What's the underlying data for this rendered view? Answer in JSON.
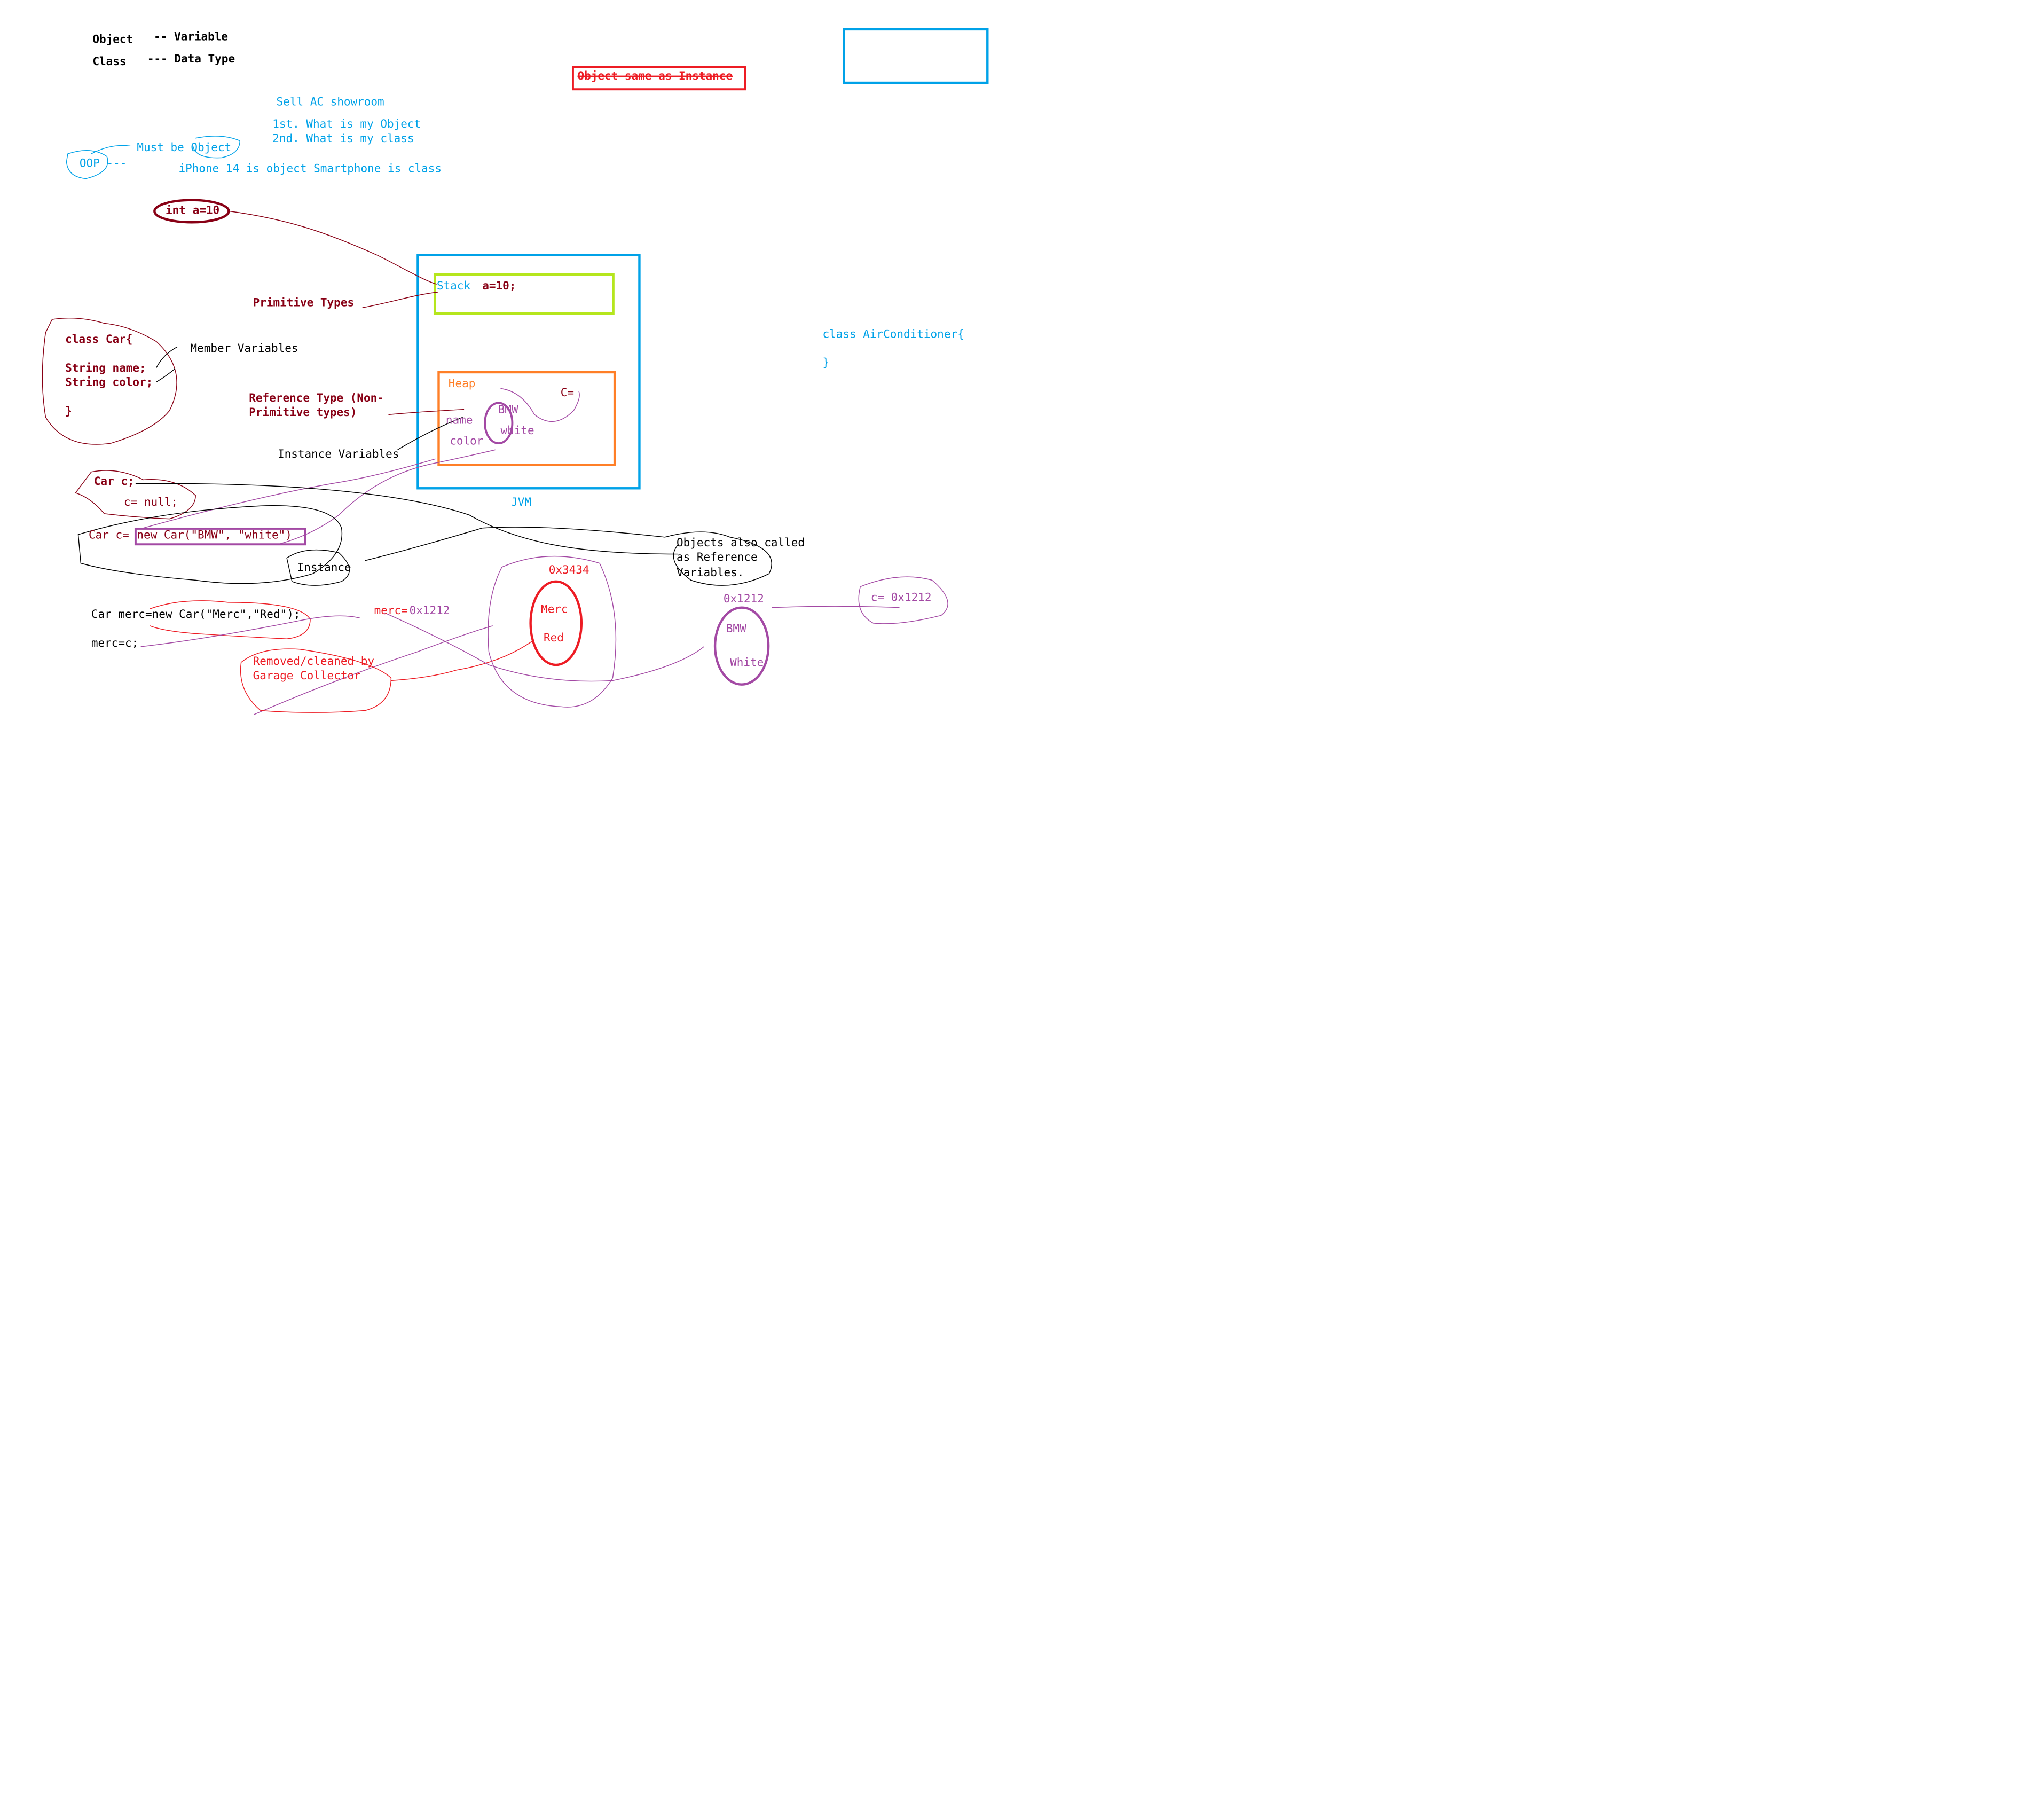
{
  "colors": {
    "blue": "#00a2e8",
    "dark_red": "#880015",
    "red": "#ed1c24",
    "purple": "#a349a4",
    "orange": "#ff7f27",
    "green": "#b5e61d",
    "black": "#000000"
  },
  "notes": {
    "object_label": "Object",
    "object_def": "-- Variable",
    "class_label": "Class",
    "class_def": "--- Data Type",
    "object_same_instance": "Object same as Instance",
    "sell_ac": "Sell AC showroom",
    "first": "1st. What is my Object",
    "second": "2nd. What is my class",
    "must_be_object": "Must be Object",
    "oop": "OOP ---",
    "iphone": "iPhone 14 is object Smartphone is class",
    "int_a": "int a=10",
    "primitive_types": "Primitive Types",
    "reference_type_1": "Reference Type (Non-",
    "reference_type_2": "Primitive types)",
    "member_variables": "Member Variables",
    "instance_variables": "Instance Variables",
    "instance": "Instance",
    "objects_also_1": "Objects also called",
    "objects_also_2": "as Reference",
    "objects_also_3": "Variables.",
    "removed_1": "Removed/cleaned by",
    "removed_2": "Garage Collector"
  },
  "class_car": {
    "line1": "class Car{",
    "line2": "String name;",
    "line3": "String color;",
    "line4": "}"
  },
  "class_ac": {
    "line1": "class AirConditioner{",
    "line2": "}"
  },
  "jvm": {
    "label": "JVM",
    "stack_label": "Stack",
    "stack_value": "a=10;",
    "heap_label": "Heap",
    "heap_c": "C=",
    "heap_name": "name",
    "heap_color": "color",
    "heap_bmw": "BMW",
    "heap_white": "white"
  },
  "code": {
    "car_c": "Car c;",
    "c_null": "c= null;",
    "car_c_eq": "Car c=",
    "new_car": "new Car(\"BMW\", \"white\")",
    "car_merc": "Car merc=new Car(\"Merc\",\"Red\");",
    "merc_eq_c": "merc=c;"
  },
  "memory": {
    "merc_prefix": "merc=",
    "merc_addr": "0x1212",
    "addr_3434": "0x3434",
    "merc_name": "Merc",
    "merc_color": "Red",
    "addr_1212": "0x1212",
    "bmw_name": "BMW",
    "bmw_color": "White",
    "c_ref": "c= 0x1212"
  }
}
